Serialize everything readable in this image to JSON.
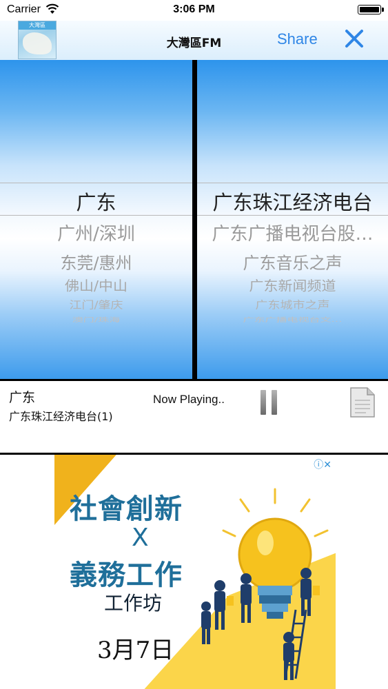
{
  "status_bar": {
    "carrier": "Carrier",
    "time": "3:06 PM"
  },
  "nav": {
    "title": "大灣區FM",
    "share_label": "Share",
    "logo_text": "大灣區",
    "close_icon": "close-icon"
  },
  "picker_left": {
    "selected": "广东",
    "items": [
      "广州/深圳",
      "东莞/惠州",
      "佛山/中山",
      "江门/肇庆",
      "澳门/珠海"
    ]
  },
  "picker_right": {
    "selected": "广东珠江经济电台",
    "items": [
      "广东广播电视台股…",
      "广东音乐之声",
      "广东新闻频道",
      "广东城市之声",
      "广东广播电视台文…"
    ]
  },
  "player": {
    "province": "广东",
    "station": "广东珠江经济电台(1)",
    "status": "Now Playing..",
    "pause_icon": "pause-icon",
    "doc_icon": "document-icon"
  },
  "ad": {
    "info_close": "ⓘ✕",
    "line1": "社會創新",
    "line2": "X",
    "line3": "義務工作",
    "line4": "工作坊",
    "line5": "3月7日"
  },
  "colors": {
    "accent": "#2f86e6",
    "picker_blue": "#2d94ec",
    "ad_yellow": "#fbd54a",
    "ad_text": "#1f6f9a"
  }
}
